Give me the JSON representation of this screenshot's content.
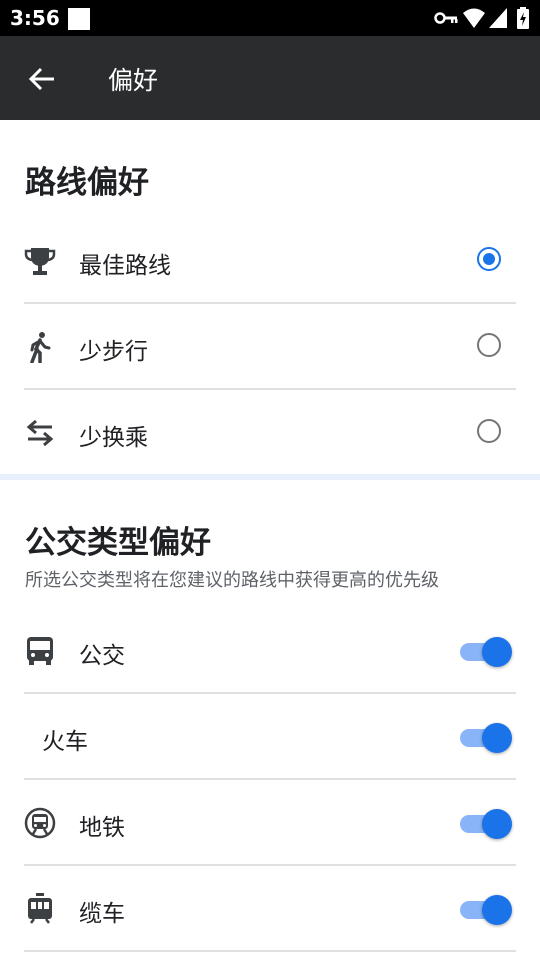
{
  "status_bar": {
    "time": "3:56"
  },
  "app_bar": {
    "title": "偏好"
  },
  "route_section": {
    "title": "路线偏好",
    "options": [
      {
        "label": "最佳路线",
        "icon": "trophy-icon",
        "selected": true
      },
      {
        "label": "少步行",
        "icon": "walk-icon",
        "selected": false
      },
      {
        "label": "少换乘",
        "icon": "transfer-icon",
        "selected": false
      }
    ]
  },
  "transit_section": {
    "title": "公交类型偏好",
    "subtitle": "所选公交类型将在您建议的路线中获得更高的优先级",
    "types": [
      {
        "label": "公交",
        "icon": "bus-icon",
        "enabled": true
      },
      {
        "label": "火车",
        "icon": "",
        "enabled": true
      },
      {
        "label": "地铁",
        "icon": "subway-icon",
        "enabled": true
      },
      {
        "label": "缆车",
        "icon": "cable-car-icon",
        "enabled": true
      }
    ]
  },
  "colors": {
    "accent": "#1a73e8",
    "track": "#8ab4f8",
    "app_bar": "#2b2c2e"
  }
}
